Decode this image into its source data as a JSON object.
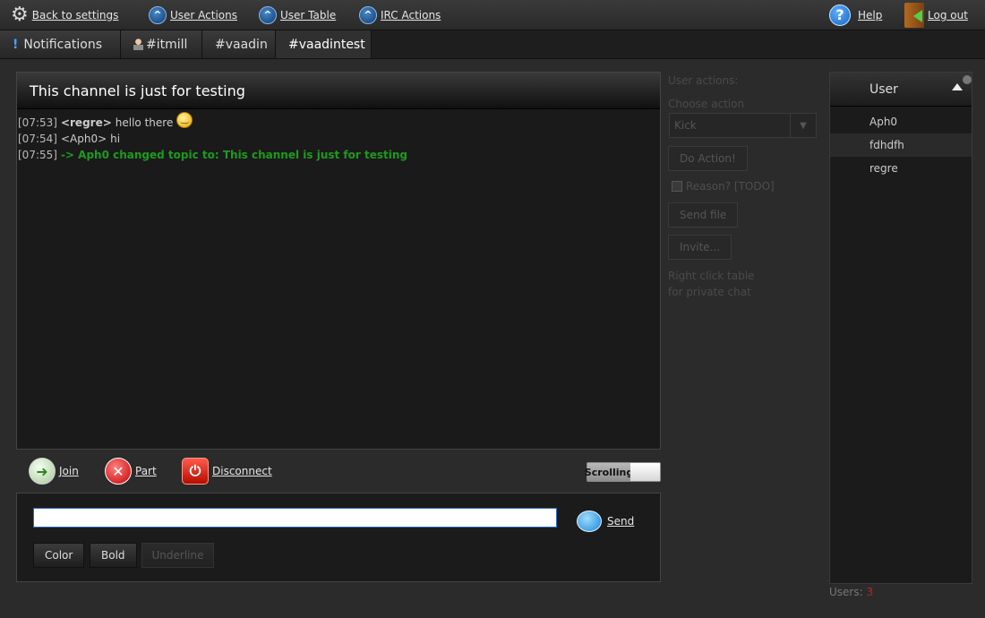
{
  "topbar": {
    "back_to_settings": "Back to settings",
    "user_actions": "User Actions",
    "user_table": "User Table",
    "irc_actions": "IRC Actions",
    "help": "Help",
    "log_out": "Log out"
  },
  "tabs": [
    {
      "label": "Notifications",
      "icon": "exclamation-icon"
    },
    {
      "label": "#itmill",
      "icon": "user-icon"
    },
    {
      "label": "#vaadin"
    },
    {
      "label": "#vaadintest",
      "active": true
    }
  ],
  "channel": {
    "topic": "This channel is just for testing",
    "messages": [
      {
        "time": "[07:53]",
        "nick": "<regre>",
        "text": "hello there"
      },
      {
        "time": "[07:54]",
        "nick": "<Aph0>",
        "text": "hi"
      },
      {
        "time": "[07:55]",
        "text": "-> Aph0 changed topic to: This channel is just for testing"
      }
    ]
  },
  "actions": {
    "join": "Join",
    "part": "Part",
    "disconnect": "Disconnect",
    "scrolling": "Scrolling"
  },
  "input": {
    "value": "",
    "send": "Send",
    "color": "Color",
    "bold": "Bold",
    "underline": "Underline"
  },
  "user_actions": {
    "title": "User actions:",
    "choose_action": "Choose action",
    "selected": "Kick",
    "do_action": "Do Action!",
    "reason": "Reason? [TODO]",
    "send_file": "Send file",
    "invite": "Invite...",
    "hint_line1": "Right click table",
    "hint_line2": "for private chat"
  },
  "user_table": {
    "header": "User",
    "users": [
      "Aph0",
      "fdhdfh",
      "regre"
    ],
    "count_label": "Users:",
    "count": "3"
  },
  "colors": {
    "topic_green": "#1d9b1d",
    "count_red": "#c02020"
  }
}
